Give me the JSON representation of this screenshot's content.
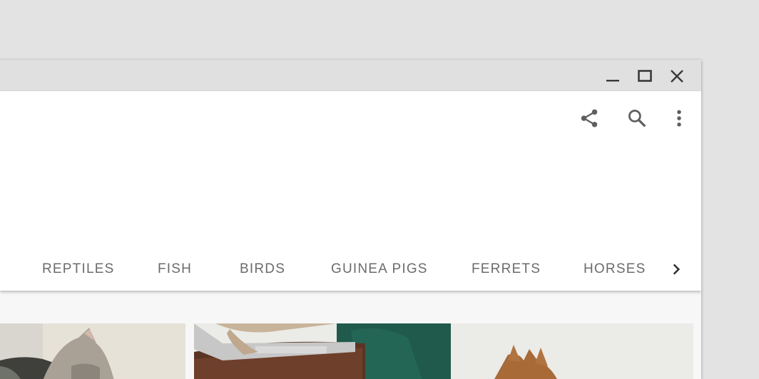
{
  "window": {
    "controls": {
      "minimize_icon": "minimize-icon",
      "maximize_icon": "maximize-icon",
      "close_icon": "close-icon"
    }
  },
  "appbar": {
    "actions": [
      {
        "icon": "share-icon"
      },
      {
        "icon": "search-icon"
      },
      {
        "icon": "more-vert-icon"
      }
    ]
  },
  "tabs": {
    "items": [
      {
        "label": "REPTILES"
      },
      {
        "label": "FISH"
      },
      {
        "label": "BIRDS"
      },
      {
        "label": "GUINEA PIGS"
      },
      {
        "label": "FERRETS"
      },
      {
        "label": "HORSES"
      }
    ],
    "next_icon": "chevron-right-icon"
  },
  "colors": {
    "desktop": "#e3e3e3",
    "titlebar": "#e0e0e0",
    "appbar": "#ffffff",
    "tab_text": "#6b6b6b",
    "icon": "#5f5f5f"
  },
  "gallery": {
    "cards": [
      {
        "subject": "cat-photo-left"
      },
      {
        "subject": "cat-with-laptop-photo"
      }
    ]
  }
}
